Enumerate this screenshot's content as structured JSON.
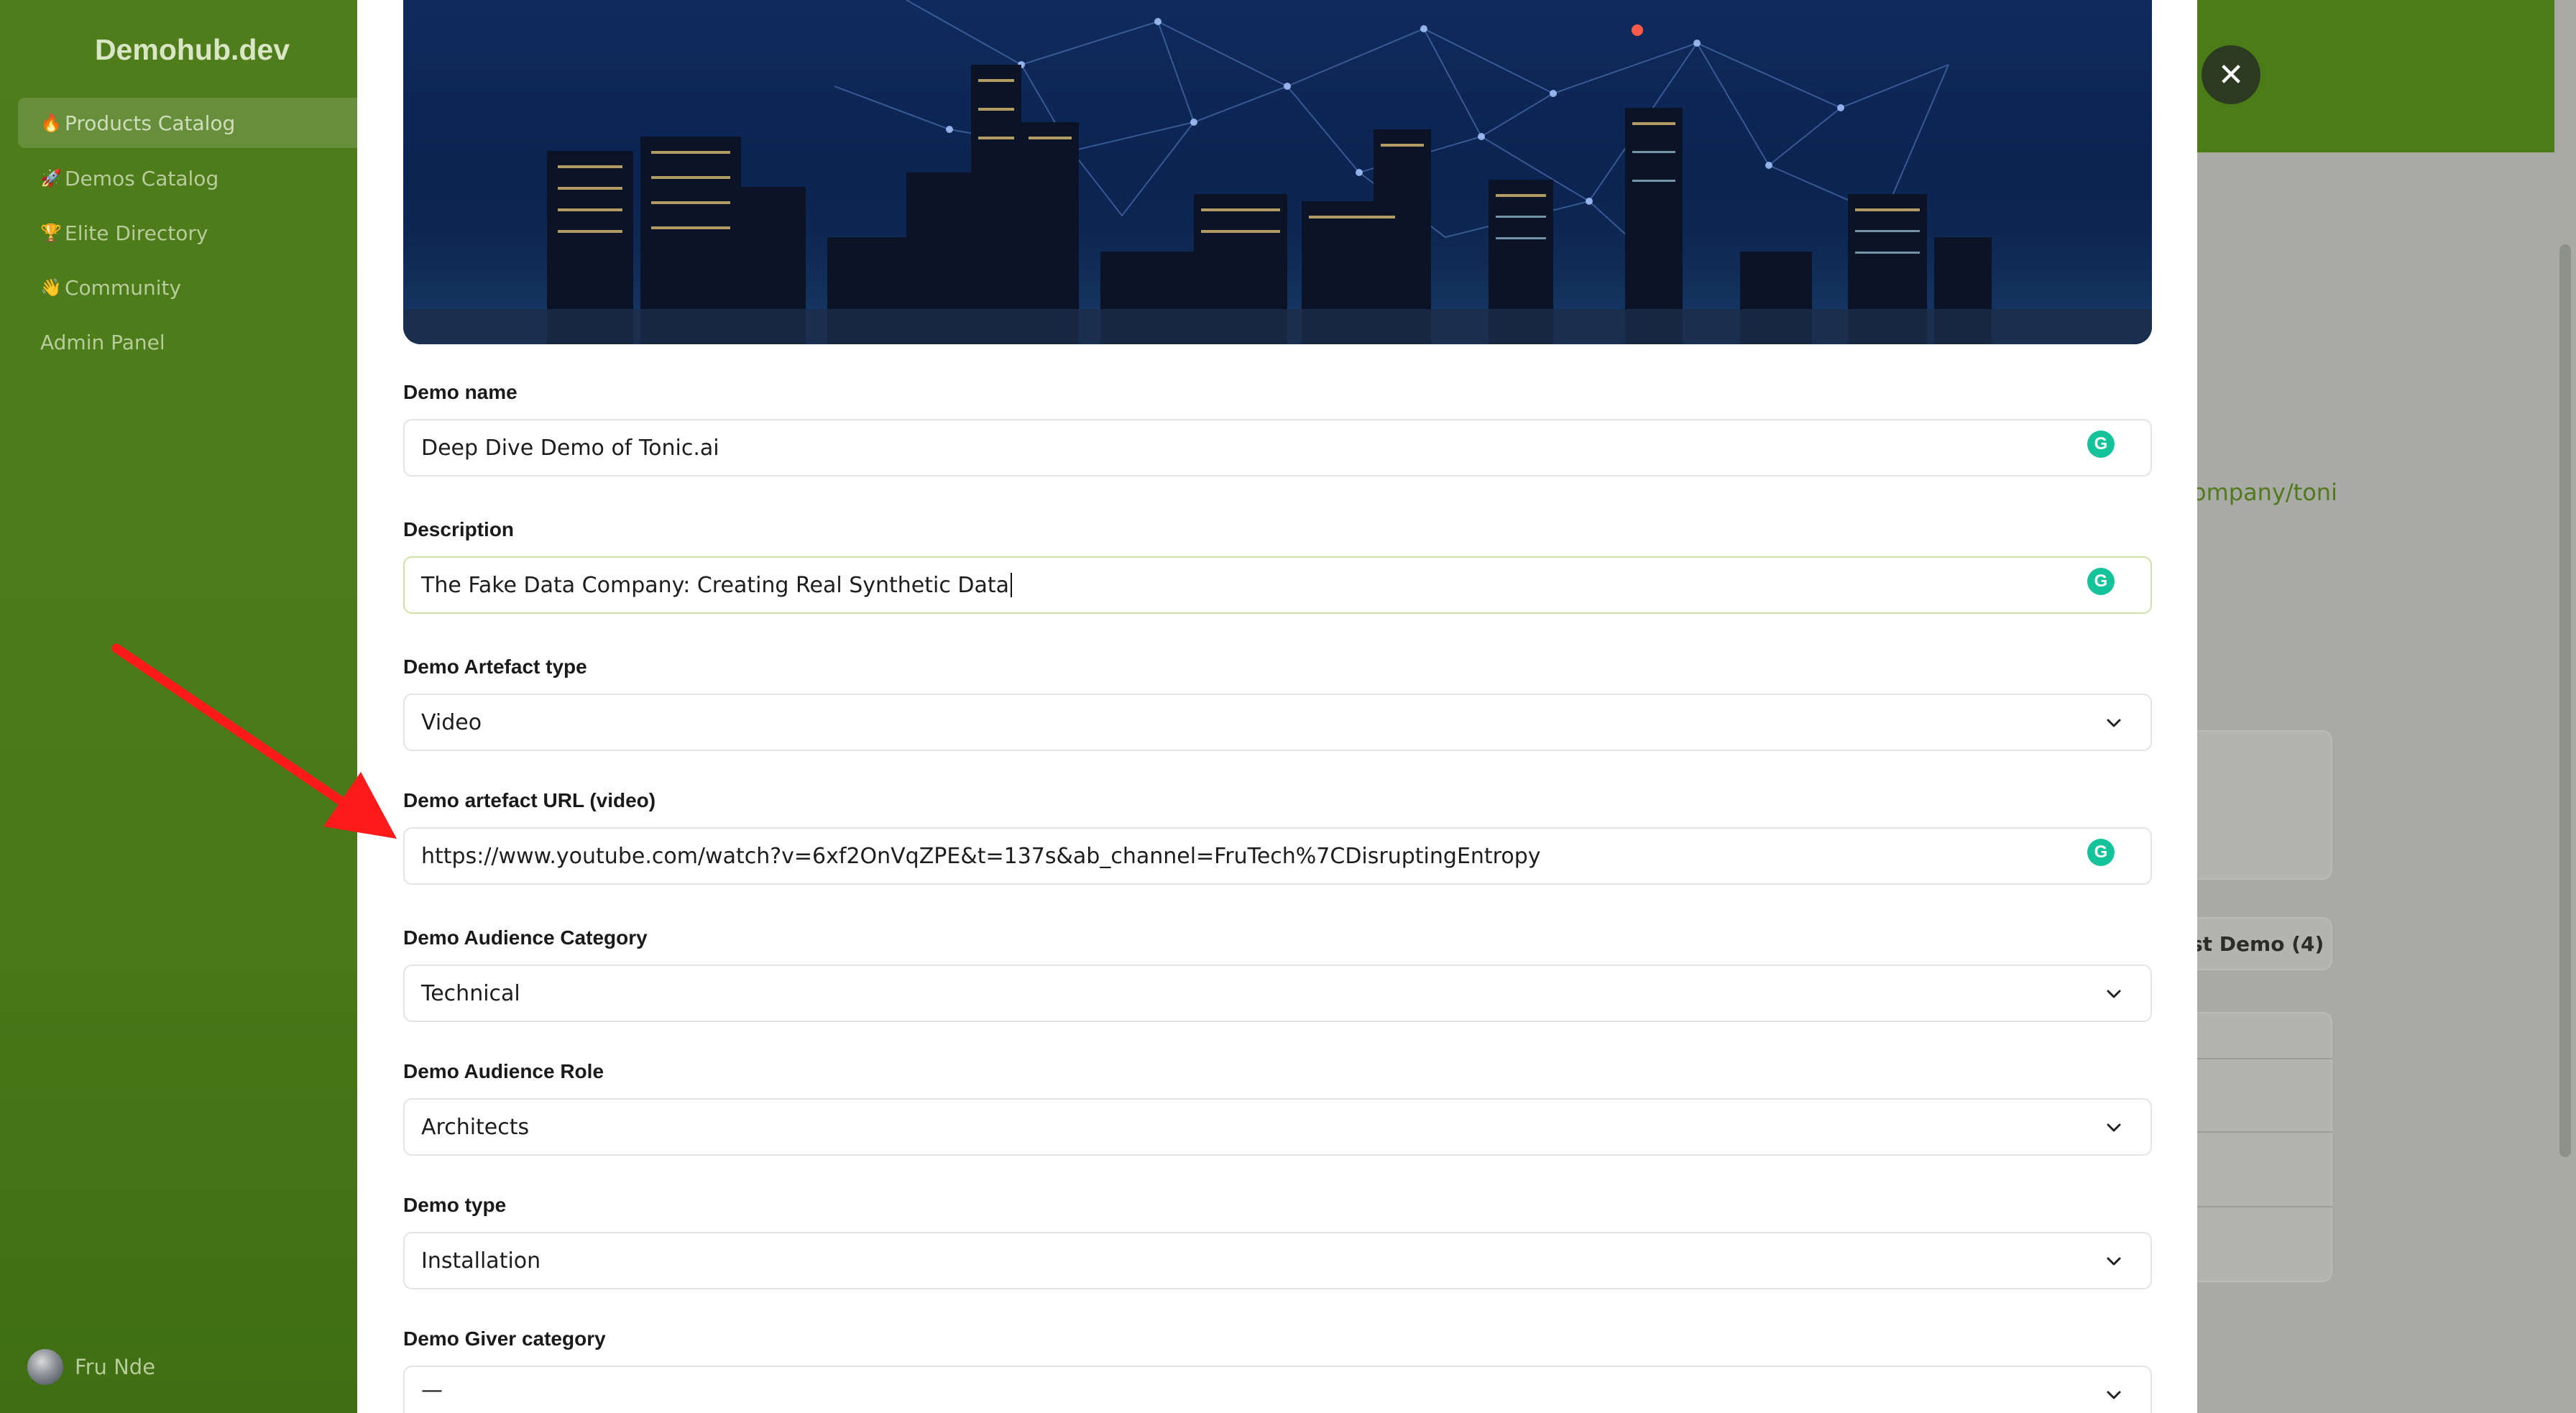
{
  "sidebar": {
    "brand": "Demohub.dev",
    "items": [
      {
        "emoji": "🔥",
        "label": "Products Catalog",
        "active": true
      },
      {
        "emoji": "🚀",
        "label": "Demos Catalog",
        "active": false
      },
      {
        "emoji": "🏆",
        "label": "Elite Directory",
        "active": false
      },
      {
        "emoji": "👋",
        "label": "Community",
        "active": false
      },
      {
        "emoji": "",
        "label": "Admin Panel",
        "active": false
      }
    ],
    "user": {
      "name": "Fru Nde"
    }
  },
  "background_page": {
    "link_fragment": "ompany/toni",
    "button_fragment": "st Demo (4)"
  },
  "modal": {
    "close_icon": "close-icon",
    "banner": {
      "description": "city-skyline-network-banner"
    },
    "fields": {
      "demo_name": {
        "label": "Demo name",
        "value": "Deep Dive Demo of Tonic.ai"
      },
      "description": {
        "label": "Description",
        "value": "The Fake Data Company: Creating Real Synthetic Data"
      },
      "artefact_type": {
        "label": "Demo Artefact type",
        "value": "Video"
      },
      "artefact_url": {
        "label": "Demo artefact URL (video)",
        "value": "https://www.youtube.com/watch?v=6xf2OnVqZPE&t=137s&ab_channel=FruTech%7CDisruptingEntropy"
      },
      "audience_category": {
        "label": "Demo Audience Category",
        "value": "Technical"
      },
      "audience_role": {
        "label": "Demo Audience Role",
        "value": "Architects"
      },
      "demo_type": {
        "label": "Demo type",
        "value": "Installation"
      },
      "giver_category": {
        "label": "Demo Giver category",
        "value": "—"
      }
    },
    "grammarly_icon_letter": "G"
  },
  "colors": {
    "sidebar": "#4a7a18",
    "header": "#4b7c17",
    "accent": "#15c39a",
    "annotation": "#ff1a1a"
  }
}
